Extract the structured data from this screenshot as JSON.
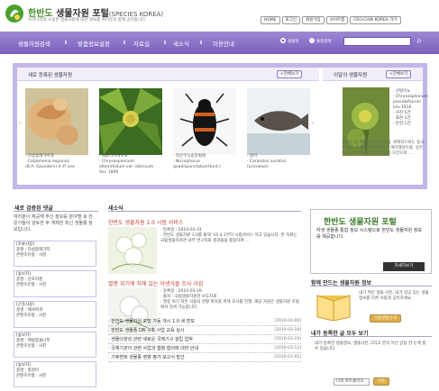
{
  "header": {
    "brand_prefix": "한반도",
    "brand_main": " 생물자원 포털",
    "brand_en": "(SPECIES KOREA)",
    "tagline": "우리나라의 소중한 생물자원에 대한 정보를 여러분과 함께 공유합니다.",
    "top_links": [
      "HOME",
      "로그인",
      "회원가입",
      "사이트맵",
      "CEO·CHW KOREA 가기"
    ]
  },
  "nav": {
    "items": [
      "생물자원검색",
      "맞춤정보설정",
      "자료실",
      "새소식",
      "이용안내"
    ],
    "radio_labels": [
      "생물명",
      "통합검색"
    ]
  },
  "feature": {
    "heading": "새로 등록된 생물자원",
    "more": "+전체보기",
    "cards": [
      {
        "cap": "· 다섬봉래가지과\n· Cotjomenia expansa\n(B.A. Saunders) V.-P. Lee"
      },
      {
        "cap": "· 새밭라이핵이노\n· Chrysosplenium\nalternifolium var. sibiricum\nSer. 1890"
      },
      {
        "cap": "· 작은무늬송장벌레\n· Nicrophorus\nquadripunctatus(Hunt.)"
      },
      {
        "cap": "· 붕어\n· Carassius auratus\n(Linnaeus)"
      }
    ],
    "recent_heading": "이달의 생물자원",
    "recent_more": "+전체보기",
    "recent_caption": "· 선왕이노\n· Chrysosplenium\npseudofauriei\nLév.1910\n· 사진:5건\n· 표본:1건\n· 문헌:1건",
    "recent_desc": "한반도 및 제주도에 자생하며, 세계적으로는 중국, 우수리, 북 쪽 까지 분포하는 여러해살이풀. 잎은 두 (3~5) 개 줄기 끝 에 달린 모양으로 ..."
  },
  "left": {
    "title": "새로 검증된 댓글",
    "intro": "여러분이 제공해 주신 정보를 분야별 로 전문가들이 검토한 후 게재한 최신 생물종 정보입니다.",
    "boxes": [
      "[조류사랑]\n종명 : 다섬봉래가지\n콘텐츠유형 : 사진",
      "[숲보자]\n종명 : 산호이름\n콘텐츠유형 : 사진",
      "[곤충사랑]\n종명 : 애사마귀\n콘텐츠유형 : 사진",
      "[숲보자]\n종명 : 애잎봉돌나무\n콘텐츠유형 : 사진",
      "[숲보자]\n종명 : 질경이\n콘텐츠유형 : 사진"
    ]
  },
  "news": {
    "title": "새소식",
    "items": [
      {
        "headline": "한반도 생물자원 1.0 시범 서비스",
        "meta": "· 등록일 : 2010-03-31\n· 한반도 생물자원 1.0를 통해 '10.4.1부터 시범서비스 하고 있습니다. 본 자료는 국립생물자원관 내부 연구자료 결과물을 활용하여 ..."
      },
      {
        "headline": "멸종 위기에 처해 있는 야생식물 조사 사업",
        "meta": "· 등록일 : 2010-03-29\n· 출처 : 국립생물자원관 보도자료\n· 멸종 위기 처한 식물의 현황 파악을 위해 조사를 진행. 해당 자원은 생물자원 포털에서 검색 가능합니다."
      }
    ],
    "list": [
      {
        "t": "· 한반도 생물자원 포털 가동 개시 1.0 새 면모",
        "d": "[2010-04-06]"
      },
      {
        "t": "· 한반도 생물종 DB 구축 사업 교육 실시",
        "d": "[2010-03-19]"
      },
      {
        "t": "· 생물다양성 관련 새로운 국제기구 설립 입박",
        "d": "[2010-03-19]"
      },
      {
        "t": "· 국제기관의 관련 사업과 협정 협의에 대한 안내",
        "d": "[2010-03-12]"
      },
      {
        "t": "· 기후변화 생물종 영향 평가 보고서 발간",
        "d": "[2010-03-05]"
      }
    ]
  },
  "right": {
    "banner_title": "한반도 생물자원 포털",
    "banner_sub": "자생 생물종 통합 정보 시스템으로 한반도 생물자원 정보를 제공합니다.",
    "banner_btn": "자세히보기",
    "s1_title": "함께 만드는 생물자원 정보",
    "s1_text": "내가 찍은 생물 사진, 내가 알고 있는 생물 정보를 다른 사람과 공유하세요.",
    "s1_btn": "이용방법안내",
    "s2_title": "내가 등록한 글 모두 보기",
    "s2_text": "내가 등록한 생물정보, 생물사진 그리고 문의 하신 글을 한 눈에 볼 수 있습니다.",
    "select": "나의 포트폴리오",
    "s2_btn": "이동"
  }
}
